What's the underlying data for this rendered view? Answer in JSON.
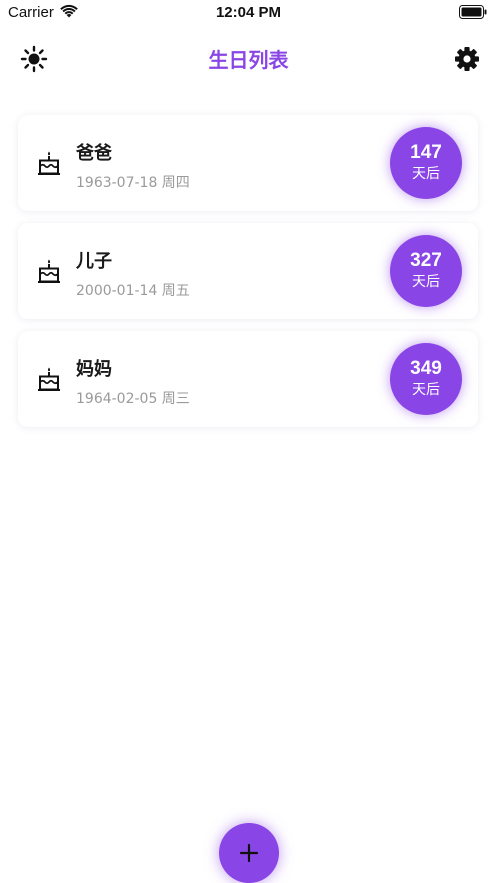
{
  "status_bar": {
    "carrier": "Carrier",
    "time": "12:04 PM"
  },
  "header": {
    "title": "生日列表",
    "left_icon": "sun-icon",
    "right_icon": "gear-icon"
  },
  "birthdays": [
    {
      "name": "爸爸",
      "date": "1963-07-18 周四",
      "days": "147",
      "unit": "天后"
    },
    {
      "name": "儿子",
      "date": "2000-01-14 周五",
      "days": "327",
      "unit": "天后"
    },
    {
      "name": "妈妈",
      "date": "1964-02-05 周三",
      "days": "349",
      "unit": "天后"
    }
  ],
  "fab": {
    "icon": "plus-icon"
  },
  "colors": {
    "accent": "#8a45e6",
    "secondary_text": "#9a9a9a",
    "primary_text": "#1a1a1a"
  }
}
